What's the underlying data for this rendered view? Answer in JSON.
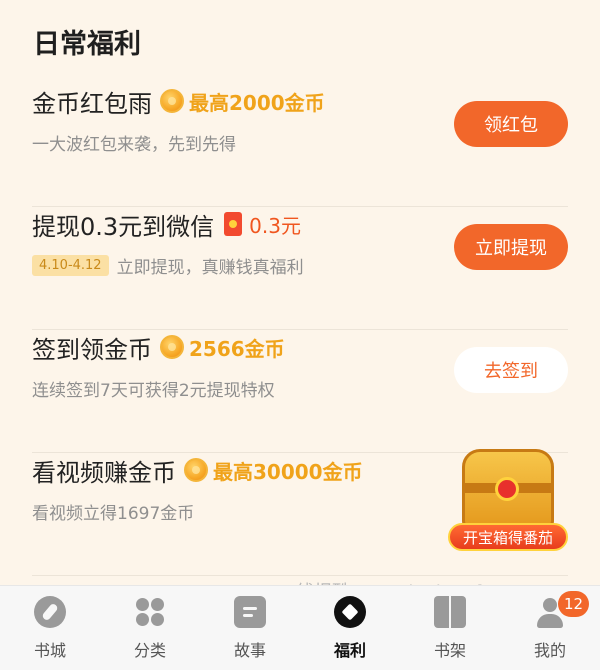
{
  "section": {
    "title": "日常福利"
  },
  "rows": [
    {
      "title": "金币红包雨",
      "reward": "最高2000金币",
      "reward_icon": "coin-icon",
      "subtitle": "一大波红包来袭，先到先得",
      "button": "领红包"
    },
    {
      "title": "提现0.3元到微信",
      "reward": "0.3元",
      "reward_icon": "red-envelope-icon",
      "tag": "4.10-4.12",
      "subtitle": "立即提现，真赚钱真福利",
      "button": "立即提现"
    },
    {
      "title": "签到领金币",
      "reward": "2566金币",
      "reward_icon": "coin-icon",
      "subtitle": "连续签到7天可获得2元提现特权",
      "button": "去签到"
    },
    {
      "title": "看视频赚金币",
      "reward": "最高30000金币",
      "reward_icon": "coin-icon",
      "subtitle": "看视频立得1697金币",
      "chest_label": "开宝箱得番茄"
    }
  ],
  "partial_row_text": "",
  "watermark": "线报酷-new.xianbao.fun",
  "tabbar": [
    {
      "label": "书城",
      "icon": "compass-icon"
    },
    {
      "label": "分类",
      "icon": "grid-icon"
    },
    {
      "label": "故事",
      "icon": "document-icon"
    },
    {
      "label": "福利",
      "icon": "welfare-icon",
      "active": true
    },
    {
      "label": "书架",
      "icon": "book-icon"
    },
    {
      "label": "我的",
      "icon": "user-icon",
      "badge": "12"
    }
  ],
  "colors": {
    "accent": "#f2672a",
    "reward_gold": "#f0a31a",
    "background": "#fdf5ea"
  }
}
